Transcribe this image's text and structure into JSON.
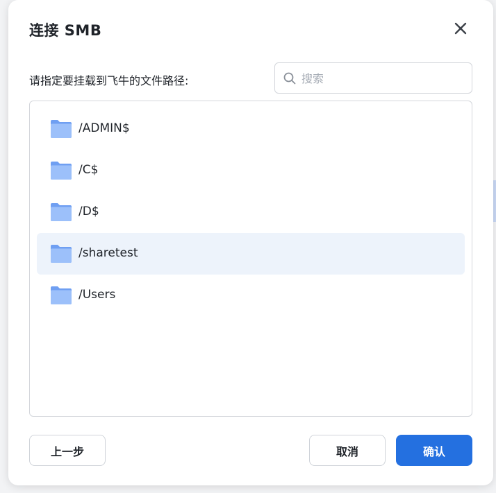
{
  "dialog": {
    "title": "连接 SMB",
    "prompt": "请指定要挂载到飞牛的文件路径:"
  },
  "search": {
    "placeholder": "搜索",
    "value": ""
  },
  "folders": [
    {
      "label": "/ADMIN$",
      "selected": false
    },
    {
      "label": "/C$",
      "selected": false
    },
    {
      "label": "/D$",
      "selected": false
    },
    {
      "label": "/sharetest",
      "selected": true
    },
    {
      "label": "/Users",
      "selected": false
    }
  ],
  "buttons": {
    "prev": "上一步",
    "cancel": "取消",
    "confirm": "确认"
  },
  "icons": {
    "close": "close-icon",
    "search": "search-icon",
    "folder": "folder-icon"
  },
  "colors": {
    "primary": "#2470e0",
    "selected_row": "#edf3fb",
    "folder": "#8fb6f7"
  }
}
